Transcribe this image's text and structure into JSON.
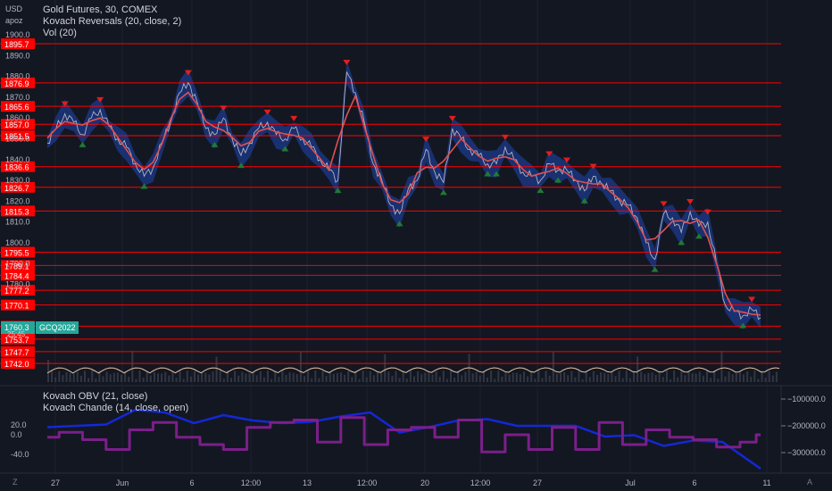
{
  "chart": {
    "currency": "USD",
    "user": "apoz",
    "legend": {
      "title": "Gold Futures, 30, COMEX",
      "indicator1": "Kovach Reversals (20, close, 2)",
      "indicator2": "Vol (20)",
      "sub1": "Kovach OBV (21, close)",
      "sub2": "Kovach Chande (14, close, open)"
    },
    "current_price_tag": "1760.3",
    "current_time_tag": "25:45",
    "symbol_tag": "GCQ2022",
    "bottom_left": "Z",
    "bottom_right": "A"
  },
  "colors": {
    "background": "#131722",
    "level_line": "#ff0000",
    "level_label_bg": "#ff0000",
    "price_line": "#b0b3bd",
    "ma_line": "#e05050",
    "band_fill": "#1c3a8c",
    "up_marker": "#1e7b33",
    "down_marker": "#e01e1e",
    "obv_line": "#1428d6",
    "chande_line": "#7b1f8a",
    "tag_teal": "#26a69a"
  },
  "chart_data": [
    {
      "type": "line",
      "title": "Gold Futures, 30, COMEX",
      "ylim": [
        1740,
        1905
      ],
      "y_ticks": [
        1900.0,
        1890.0,
        1880.0,
        1870.0,
        1860.0,
        1850.0,
        1840.0,
        1830.0,
        1820.0,
        1810.0,
        1800.0,
        1790.0,
        1780.0
      ],
      "x_ticks": [
        "27",
        "Jun",
        "6",
        "12:00",
        "13",
        "12:00",
        "20",
        "12:00",
        "27",
        "Jul",
        "6",
        "11"
      ],
      "levels": [
        1895.7,
        1876.9,
        1865.6,
        1857.0,
        1851.5,
        1836.6,
        1826.7,
        1815.3,
        1795.5,
        1789.1,
        1784.4,
        1777.2,
        1770.1,
        1759.9,
        1753.7,
        1747.7,
        1742.0
      ],
      "series": [
        {
          "x": [
            0,
            3,
            6,
            9,
            12,
            15,
            18,
            21,
            24,
            27,
            30,
            33,
            36,
            39,
            42,
            45,
            48,
            51,
            54,
            57,
            60,
            63,
            66,
            69,
            72,
            75,
            78,
            81,
            84,
            87,
            90,
            93,
            96,
            99,
            102,
            105,
            108,
            111,
            114,
            117,
            120,
            123,
            126,
            129,
            132,
            135,
            138,
            141,
            144,
            147,
            150,
            153,
            156,
            159,
            162,
            165,
            168,
            171,
            174,
            177,
            180,
            183,
            186,
            189,
            192,
            195,
            198,
            201,
            204,
            207,
            210,
            213,
            216,
            219,
            222,
            225,
            228,
            231,
            234,
            237,
            240,
            243
          ],
          "values": [
            1848,
            1855,
            1862,
            1858,
            1852,
            1860,
            1864,
            1856,
            1850,
            1846,
            1838,
            1832,
            1836,
            1848,
            1858,
            1872,
            1877,
            1868,
            1855,
            1852,
            1860,
            1850,
            1842,
            1848,
            1855,
            1858,
            1852,
            1850,
            1855,
            1850,
            1846,
            1840,
            1835,
            1830,
            1882,
            1872,
            1858,
            1838,
            1830,
            1818,
            1814,
            1826,
            1830,
            1845,
            1834,
            1829,
            1855,
            1850,
            1845,
            1842,
            1838,
            1838,
            1846,
            1840,
            1834,
            1832,
            1830,
            1838,
            1835,
            1835,
            1830,
            1825,
            1832,
            1828,
            1825,
            1820,
            1818,
            1812,
            1800,
            1792,
            1814,
            1812,
            1805,
            1815,
            1808,
            1810,
            1790,
            1770,
            1767,
            1765,
            1768,
            1764
          ]
        }
      ]
    },
    {
      "type": "line",
      "title": "Kovach OBV (21, close)",
      "y_ticks": [
        -100000.0,
        -200000.0,
        -300000.0
      ],
      "series": [
        {
          "name": "Kovach OBV",
          "x": [
            0,
            10,
            20,
            30,
            40,
            50,
            60,
            70,
            80,
            90,
            100,
            110,
            120,
            130,
            140,
            150,
            160,
            170,
            180,
            190,
            200,
            210,
            220,
            230,
            243
          ],
          "values": [
            -205000,
            -200000,
            -195000,
            -140000,
            -150000,
            -190000,
            -160000,
            -180000,
            -190000,
            -185000,
            -165000,
            -150000,
            -225000,
            -205000,
            -180000,
            -175000,
            -200000,
            -200000,
            -200000,
            -240000,
            -235000,
            -275000,
            -255000,
            -260000,
            -385000
          ]
        }
      ]
    },
    {
      "type": "line",
      "title": "Kovach Chande (14, close, open)",
      "y_ticks": [
        20.0,
        0.0,
        -40.0
      ],
      "series": [
        {
          "name": "Kovach Chande",
          "x": [
            0,
            8,
            16,
            24,
            32,
            40,
            48,
            56,
            64,
            72,
            80,
            88,
            96,
            104,
            112,
            120,
            128,
            136,
            144,
            152,
            160,
            168,
            176,
            184,
            192,
            200,
            208,
            216,
            224,
            232,
            240,
            243
          ],
          "values": [
            -5,
            5,
            -10,
            -30,
            10,
            25,
            -5,
            -20,
            -30,
            15,
            25,
            30,
            -15,
            35,
            -20,
            10,
            15,
            -5,
            30,
            -35,
            0,
            -30,
            15,
            -30,
            25,
            -20,
            10,
            -5,
            -10,
            -25,
            -15,
            0
          ]
        }
      ]
    }
  ]
}
